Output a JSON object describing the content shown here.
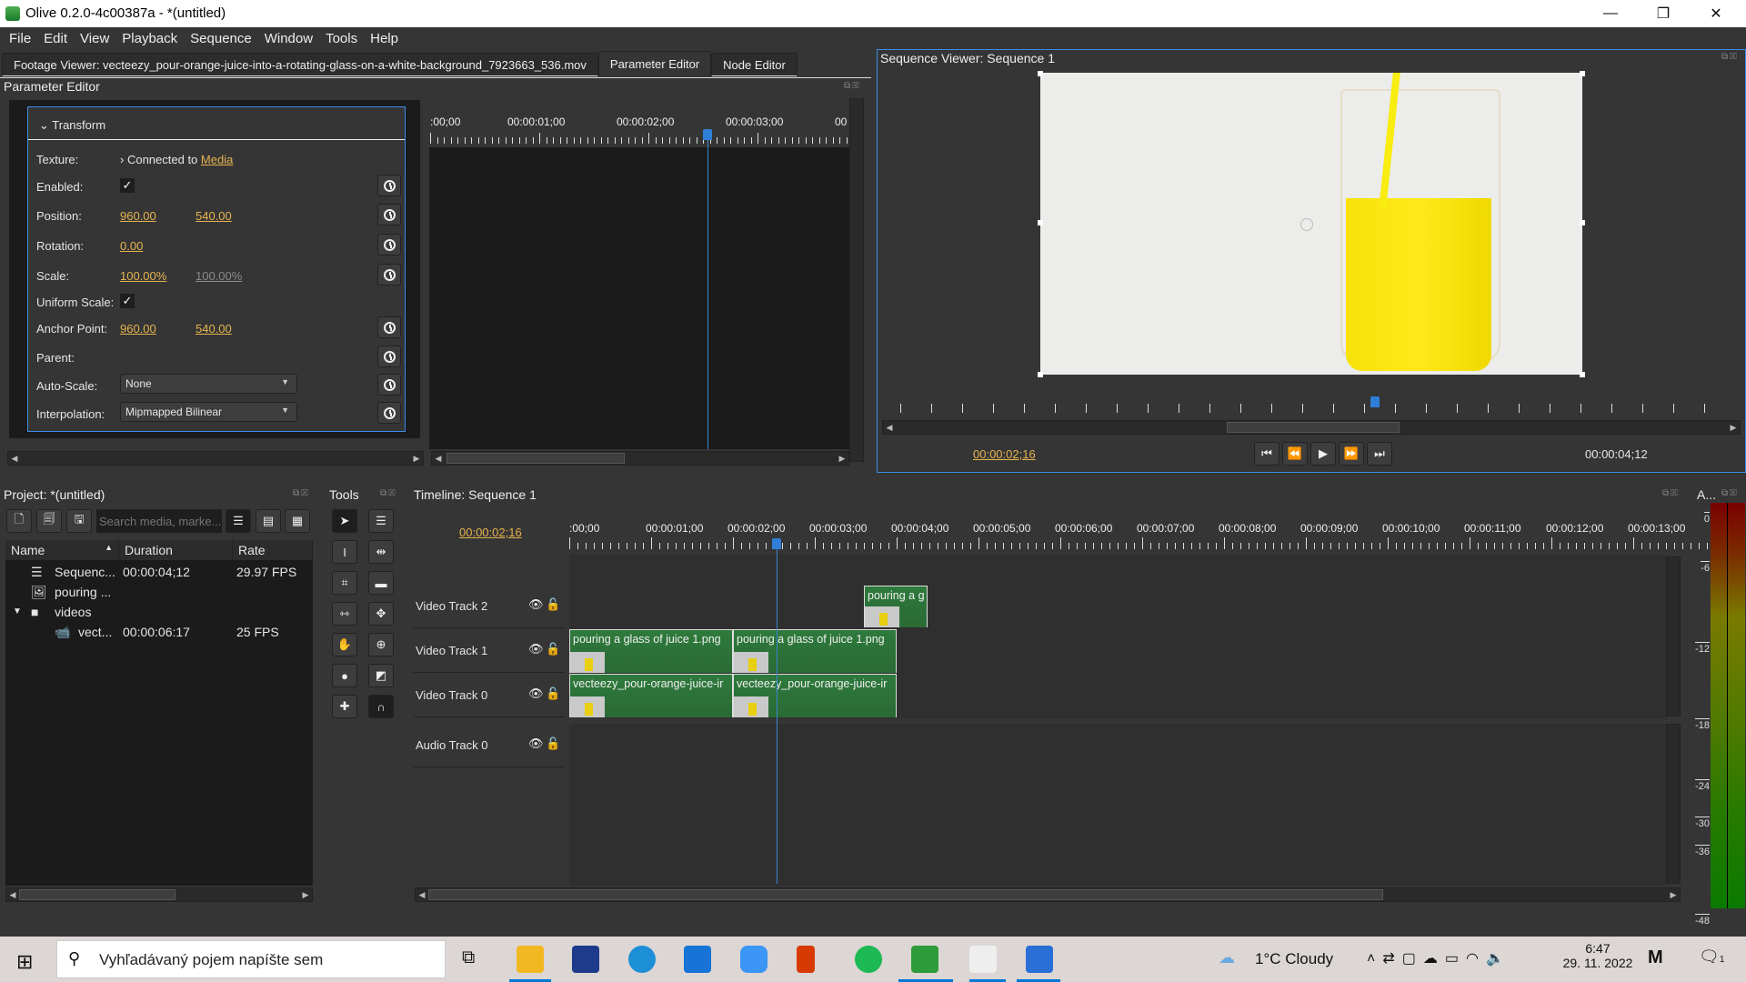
{
  "window": {
    "title": "Olive 0.2.0-4c00387a - *(untitled)",
    "controls": {
      "minimize": "—",
      "maximize": "❐",
      "close": "✕"
    }
  },
  "menu": [
    "File",
    "Edit",
    "View",
    "Playback",
    "Sequence",
    "Window",
    "Tools",
    "Help"
  ],
  "top_tabs": [
    {
      "label": "Footage Viewer: vecteezy_pour-orange-juice-into-a-rotating-glass-on-a-white-background_7923663_536.mov",
      "active": false
    },
    {
      "label": "Parameter Editor",
      "active": true
    },
    {
      "label": "Node Editor",
      "active": false
    }
  ],
  "param_editor": {
    "title": "Parameter Editor",
    "section": "Transform",
    "rows": {
      "texture": {
        "label": "Texture:",
        "prefix": "Connected to",
        "link": "Media"
      },
      "enabled": {
        "label": "Enabled:",
        "checked": true,
        "mark": "✓"
      },
      "position": {
        "label": "Position:",
        "x": "960.00",
        "y": "540.00"
      },
      "rotation": {
        "label": "Rotation:",
        "value": "0.00"
      },
      "scale": {
        "label": "Scale:",
        "x": "100.00%",
        "y": "100.00%"
      },
      "uniform_scale": {
        "label": "Uniform Scale:",
        "checked": true,
        "mark": "✓"
      },
      "anchor": {
        "label": "Anchor Point:",
        "x": "960.00",
        "y": "540.00"
      },
      "parent": {
        "label": "Parent:"
      },
      "autoscale": {
        "label": "Auto-Scale:",
        "value": "None"
      },
      "interpolation": {
        "label": "Interpolation:",
        "value": "Mipmapped Bilinear"
      }
    },
    "ruler_labels": [
      ":00;00",
      "00:00:01;00",
      "00:00:02;00",
      "00:00:03;00",
      "00"
    ]
  },
  "sequence_viewer": {
    "title": "Sequence Viewer: Sequence 1",
    "current_time": "00:00:02;16",
    "duration": "00:00:04;12",
    "playhead_fraction": 0.58
  },
  "project": {
    "title": "Project: *(untitled)",
    "search_placeholder": "Search media, marke...",
    "columns": [
      "Name",
      "Duration",
      "Rate"
    ],
    "items": [
      {
        "name": "Sequenc...",
        "duration": "00:00:04;12",
        "rate": "29.97 FPS",
        "icon": "sequence-icon",
        "indent": 1
      },
      {
        "name": "pouring ...",
        "duration": "",
        "rate": "",
        "icon": "image-icon",
        "indent": 1
      },
      {
        "name": "videos",
        "duration": "",
        "rate": "",
        "icon": "folder-icon",
        "indent": 1,
        "expanded": true
      },
      {
        "name": "vect...",
        "duration": "00:00:06:17",
        "rate": "25 FPS",
        "icon": "video-icon",
        "indent": 2
      }
    ]
  },
  "tools": {
    "title": "Tools"
  },
  "timeline": {
    "title": "Timeline: Sequence 1",
    "current_time": "00:00:02;16",
    "ruler_labels": [
      ":00;00",
      "00:00:01;00",
      "00:00:02;00",
      "00:00:03;00",
      "00:00:04;00",
      "00:00:05;00",
      "00:00:06;00",
      "00:00:07;00",
      "00:00:08;00",
      "00:00:09;00",
      "00:00:10;00",
      "00:00:11;00",
      "00:00:12;00",
      "00:00:13;00"
    ],
    "tracks": [
      {
        "name": "Video Track 2",
        "clips": [
          {
            "label": "pouring a g"
          }
        ]
      },
      {
        "name": "Video Track 1",
        "clips": [
          {
            "label": "pouring a glass of juice 1.png"
          },
          {
            "label": "pouring a glass of juice 1.png"
          }
        ]
      },
      {
        "name": "Video Track 0",
        "clips": [
          {
            "label": "vecteezy_pour-orange-juice-ir"
          },
          {
            "label": "vecteezy_pour-orange-juice-ir"
          }
        ]
      },
      {
        "name": "Audio Track 0",
        "clips": []
      }
    ]
  },
  "audio_monitor": {
    "title": "A...",
    "scale": [
      "0",
      "-6",
      "-12",
      "-18",
      "-24",
      "-30",
      "-36",
      "-48"
    ]
  },
  "taskbar": {
    "search_placeholder": "Vyhľadávaný pojem napíšte sem",
    "weather": "1°C  Cloudy",
    "time": "6:47",
    "date": "29. 11. 2022",
    "notification_count": "1"
  }
}
